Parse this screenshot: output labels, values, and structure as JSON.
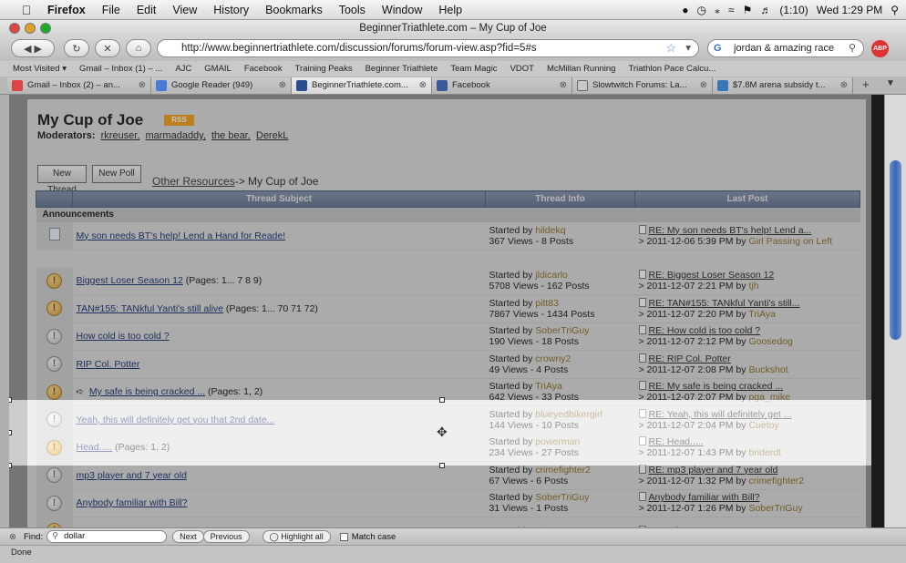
{
  "menubar": {
    "app": "Firefox",
    "items": [
      "File",
      "Edit",
      "View",
      "History",
      "Bookmarks",
      "Tools",
      "Window",
      "Help"
    ],
    "battery": "(1:10)",
    "clock": "Wed 1:29 PM"
  },
  "window": {
    "title": "BeginnerTriathlete.com – My Cup of Joe"
  },
  "navbar": {
    "url": "http://www.beginnertriathlete.com/discussion/forums/forum-view.asp?fid=5#s",
    "search_value": "jordan & amazing race"
  },
  "bookmarks": [
    "Most Visited ▾",
    "Gmail – Inbox (1) – ...",
    "AJC",
    "GMAIL",
    "Facebook",
    "Training Peaks",
    "Beginner Triathlete",
    "Team Magic",
    "VDOT",
    "McMillan Running",
    "Triathlon Pace Calcu..."
  ],
  "tabs": [
    {
      "label": "Gmail – Inbox (2) – an...",
      "active": false
    },
    {
      "label": "Google Reader (949)",
      "active": false
    },
    {
      "label": "BeginnerTriathlete.com...",
      "active": true
    },
    {
      "label": "Facebook",
      "active": false
    },
    {
      "label": "Slowtwitch Forums: La...",
      "active": false
    },
    {
      "label": "$7.8M arena subsidy t...",
      "active": false
    }
  ],
  "forum": {
    "title": "My Cup of Joe",
    "rss_label": "RSS",
    "moderators_label": "Moderators:",
    "moderators": [
      "rkreuser,",
      "marmadaddy,",
      "the bear,",
      "DerekL"
    ],
    "new_thread": "New Thread",
    "new_poll": "New Poll",
    "crumb_link": "Other Resources",
    "crumb_rest": "-> My Cup of Joe",
    "headers": [
      "Thread Subject",
      "Thread Info",
      "Last Post"
    ],
    "announcements_label": "Announcements",
    "announcement": {
      "subject": "My son needs BT's help! Lend a Hand for Reade!",
      "started_label": "Started by ",
      "started_by": "hildekq",
      "stats": "367 Views - 8 Posts",
      "last_title": "RE: My son needs BT's help! Lend a...",
      "last_date": "> 2011-12-06 5:39 PM by ",
      "last_user": "Girl Passing on Left"
    },
    "threads": [
      {
        "subject": "Biggest Loser Season 12",
        "pages": " (Pages: 1... 7 8 9)",
        "by": "jldicarlo",
        "stats": "5708 Views - 162 Posts",
        "last_title": "RE: Biggest Loser Season 12",
        "last_date": "> 2011-12-07 2:21 PM by ",
        "last_user": "tjh"
      },
      {
        "subject": "TAN#155: TANkful Yanti's still alive",
        "pages": " (Pages: 1... 70 71 72)",
        "by": "pitt83",
        "stats": "7867 Views - 1434 Posts",
        "last_title": "RE: TAN#155: TANkful Yanti's still...",
        "last_date": "> 2011-12-07 2:20 PM by ",
        "last_user": "TriAya"
      },
      {
        "subject": "How cold is too cold ?",
        "pages": "",
        "by": "SoberTriGuy",
        "stats": "190 Views - 18 Posts",
        "last_title": "RE: How cold is too cold ?",
        "last_date": "> 2011-12-07 2:12 PM by ",
        "last_user": "Goosedog"
      },
      {
        "subject": "RIP Col. Potter",
        "pages": "",
        "by": "crowny2",
        "stats": "49 Views - 4 Posts",
        "last_title": "RE: RIP Col. Potter",
        "last_date": "> 2011-12-07 2:08 PM by ",
        "last_user": "Buckshot"
      },
      {
        "subject": "My safe is being cracked ...",
        "pages": " (Pages: 1, 2)",
        "by": "TriAya",
        "stats": "642 Views - 33 Posts",
        "last_title": "RE: My safe is being cracked ...",
        "last_date": "> 2011-12-07 2:07 PM by ",
        "last_user": "pga_mike"
      },
      {
        "subject": "Yeah, this will definitely get you that 2nd date...",
        "pages": "",
        "by": "blueyedbikergirl",
        "stats": "144 Views - 10 Posts",
        "last_title": "RE: Yeah, this will definitely get ...",
        "last_date": "> 2011-12-07 2:04 PM by ",
        "last_user": "Cuetoy"
      },
      {
        "subject": "Head.....",
        "pages": " (Pages: 1, 2)",
        "by": "powerman",
        "stats": "234 Views - 27 Posts",
        "last_title": "RE: Head.....",
        "last_date": "> 2011-12-07 1:43 PM by ",
        "last_user": "briderdt"
      },
      {
        "subject": "mp3 player and 7 year old",
        "pages": "",
        "by": "crimefighter2",
        "stats": "67 Views - 6 Posts",
        "last_title": "RE: mp3 player and 7 year old",
        "last_date": "> 2011-12-07 1:32 PM by ",
        "last_user": "crimefighter2"
      },
      {
        "subject": "Anybody familiar with Bill?",
        "pages": "",
        "by": "SoberTriGuy",
        "stats": "31 Views - 1 Posts",
        "last_title": "Anybody familiar with Bill?",
        "last_date": "> 2011-12-07 1:26 PM by ",
        "last_user": "SoberTriGuy"
      },
      {
        "subject": "",
        "pages": "",
        "by": "TriAya",
        "stats": "",
        "last_title": "RE: Why are my nets SO WEIRD?!?!",
        "last_date": "",
        "last_user": ""
      }
    ]
  },
  "findbar": {
    "label": "Find:",
    "value": "dollar",
    "next": "Next",
    "previous": "Previous",
    "highlight": "Highlight all",
    "match_case": "Match case"
  },
  "status": "Done"
}
